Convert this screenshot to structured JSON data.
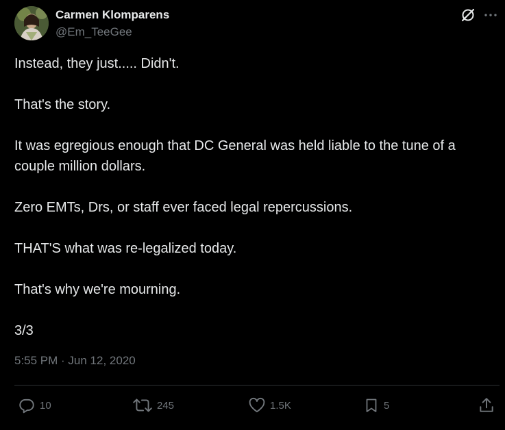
{
  "author": {
    "display_name": "Carmen Klomparens",
    "handle": "@Em_TeeGee"
  },
  "icons": {
    "grok": "grok-icon",
    "more": "more-icon",
    "reply": "reply-icon",
    "retweet": "retweet-icon",
    "like": "heart-icon",
    "bookmark": "bookmark-icon",
    "share": "share-icon"
  },
  "post": {
    "paragraphs": [
      "Instead, they just..... Didn't.",
      "That's the story.",
      "It was egregious enough that DC General was held liable to the tune of a couple million dollars.",
      "Zero EMTs, Drs, or staff ever faced legal repercussions.",
      "THAT'S what was re-legalized today.",
      "That's why we're mourning.",
      "3/3"
    ],
    "timestamp": "5:55 PM · Jun 12, 2020"
  },
  "actions": {
    "replies": "10",
    "reposts": "245",
    "likes": "1.5K",
    "bookmarks": "5"
  },
  "colors": {
    "background": "#000000",
    "text": "#e7e9ea",
    "secondary": "#71767b",
    "divider": "#2f3336"
  }
}
